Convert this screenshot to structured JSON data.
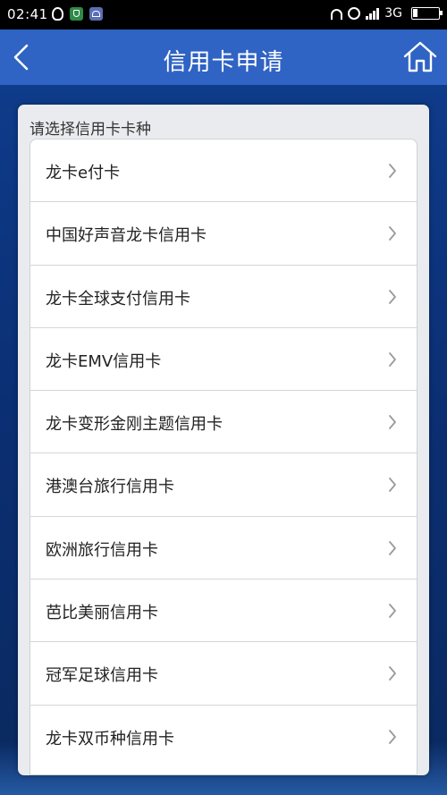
{
  "status_bar": {
    "time": "02:41",
    "network": "3G",
    "left_icons": [
      "qq-icon",
      "shield-app-icon",
      "app-icon"
    ],
    "right_icons": [
      "headset-icon",
      "alarm-icon",
      "signal-icon",
      "battery-icon"
    ]
  },
  "header": {
    "title": "信用卡申请",
    "back_icon": "chevron-left-icon",
    "home_icon": "home-icon",
    "background_color": "#2f63c4"
  },
  "main": {
    "heading": "请选择信用卡卡种",
    "items": [
      {
        "label": "龙卡e付卡"
      },
      {
        "label": "中国好声音龙卡信用卡"
      },
      {
        "label": "龙卡全球支付信用卡"
      },
      {
        "label": "龙卡EMV信用卡"
      },
      {
        "label": "龙卡变形金刚主题信用卡"
      },
      {
        "label": "港澳台旅行信用卡"
      },
      {
        "label": "欧洲旅行信用卡"
      },
      {
        "label": "芭比美丽信用卡"
      },
      {
        "label": "冠军足球信用卡"
      },
      {
        "label": "龙卡双币种信用卡"
      }
    ]
  }
}
